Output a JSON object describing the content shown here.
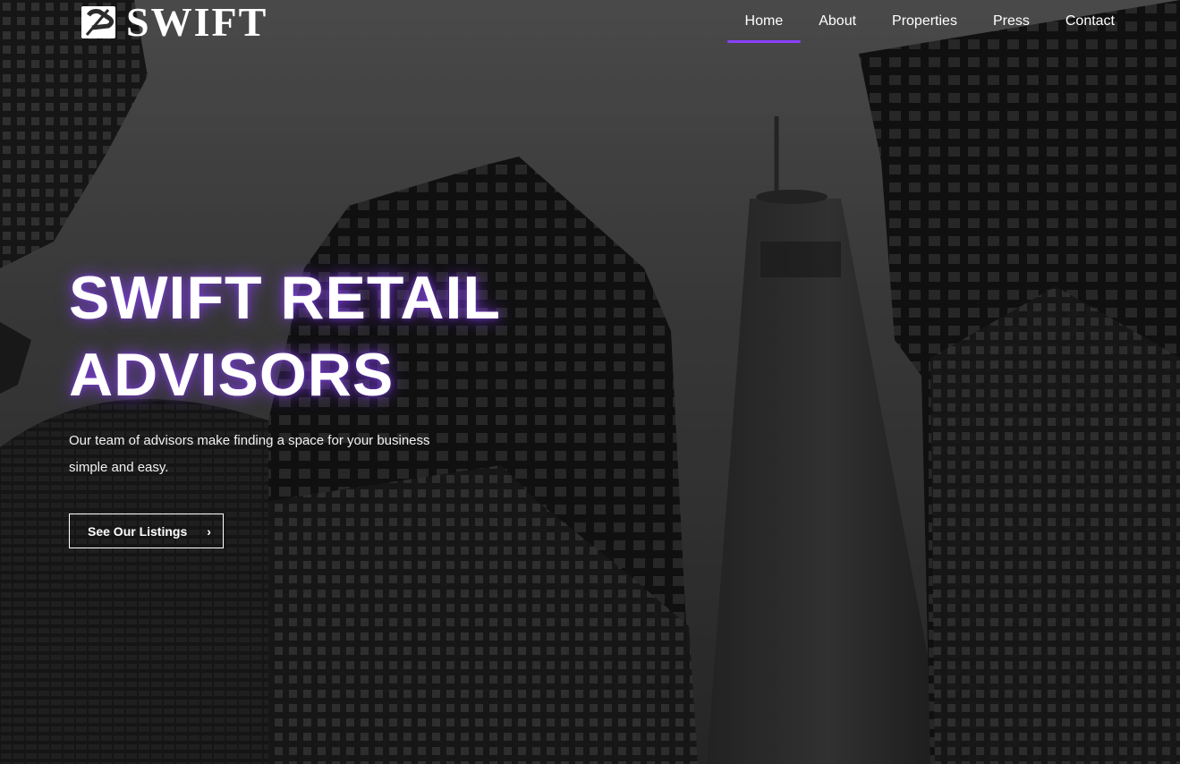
{
  "brand": {
    "logo_text": "SWIFT",
    "accent_color": "#8a3ffc"
  },
  "nav": {
    "items": [
      {
        "label": "Home",
        "active": true
      },
      {
        "label": "About",
        "active": false
      },
      {
        "label": "Properties",
        "active": false
      },
      {
        "label": "Press",
        "active": false
      },
      {
        "label": "Contact",
        "active": false
      }
    ]
  },
  "hero": {
    "headline_line1": "SWIFT RETAIL",
    "headline_line2": "ADVISORS",
    "subtext_line1": "Our team of advisors make finding a space for your business",
    "subtext_line2": "simple and easy.",
    "cta_label": "See Our Listings",
    "cta_icon": "chevron-right-icon",
    "background": "grayscale-skyscrapers-photo"
  }
}
